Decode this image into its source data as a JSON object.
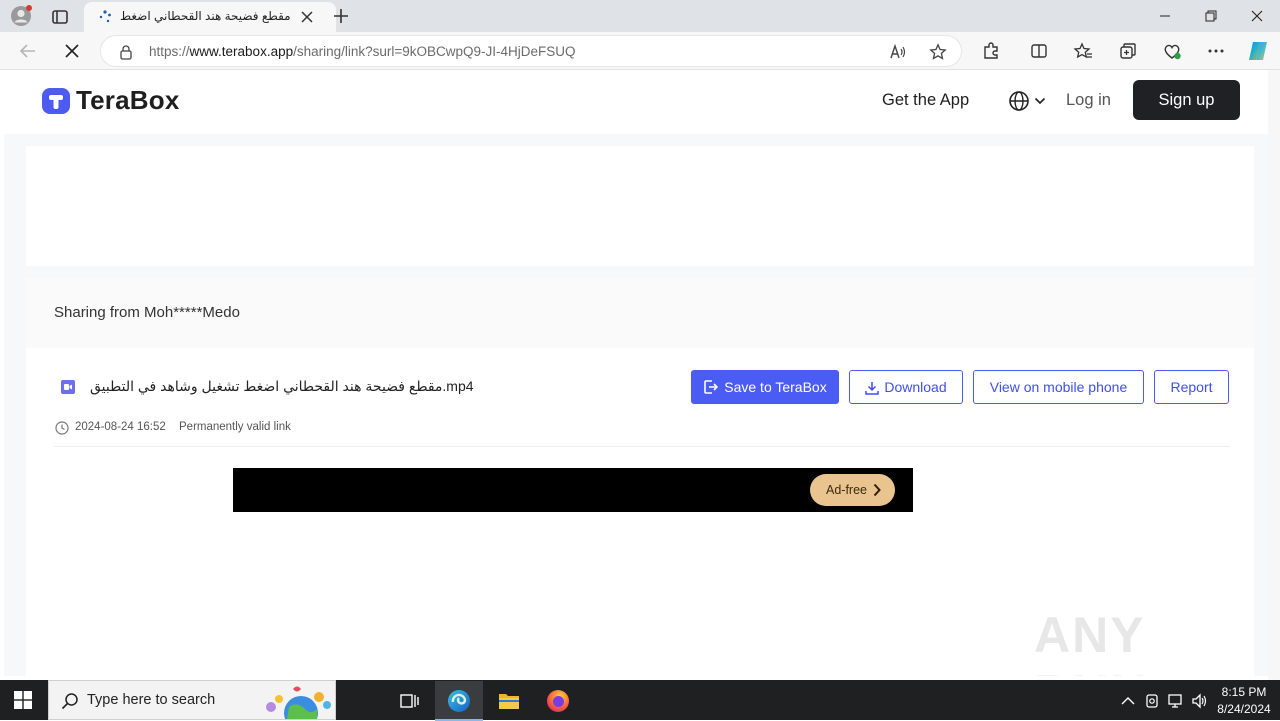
{
  "browser": {
    "tab_title": "مقطع فضيحة هند القحطاني اضغط",
    "url_prefix": "https://",
    "url_host": "www.terabox.app",
    "url_path": "/sharing/link?surl=9kOBCwpQ9-JI-4HjDeFSUQ"
  },
  "header": {
    "logo_text": "TeraBox",
    "get_app": "Get the App",
    "login": "Log in",
    "signup": "Sign up"
  },
  "share": {
    "sharing_from": "Sharing from Moh*****Medo",
    "file_name": "مقطع فضيحة هند القحطاني اضغط تشغيل وشاهد في التطبيق.mp4",
    "save_label": "Save to TeraBox",
    "download_label": "Download",
    "mobile_label": "View on mobile phone",
    "report_label": "Report",
    "date": "2024-08-24 16:52",
    "validity": "Permanently valid link",
    "adfree_label": "Ad-free"
  },
  "watermark": "ANY RUN",
  "taskbar": {
    "search_placeholder": "Type here to search",
    "time": "8:15 PM",
    "date": "8/24/2024"
  },
  "colors": {
    "accent": "#4a5cf4",
    "signup_bg": "#1f2125",
    "adfree_bg": "#e9c48e"
  }
}
